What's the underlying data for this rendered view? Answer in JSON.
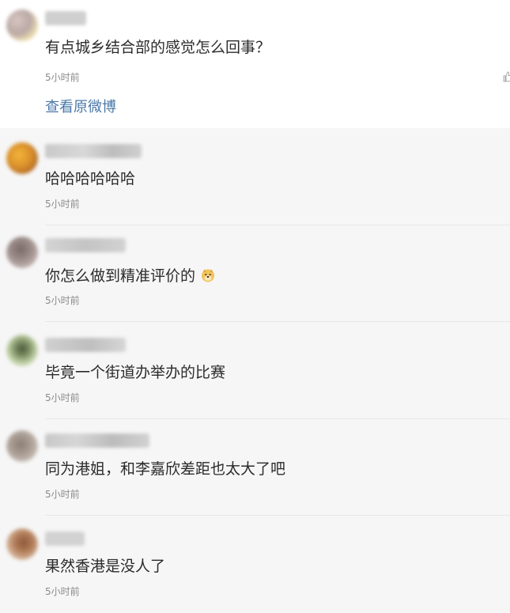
{
  "top_comment": {
    "text": "有点城乡结合部的感觉怎么回事？",
    "time": "5小时前",
    "view_original": "查看原微博",
    "like_icon": "thumbs-up-icon"
  },
  "replies": [
    {
      "text": "哈哈哈哈哈哈",
      "time": "5小时前"
    },
    {
      "text": "你怎么做到精准评价的",
      "time": "5小时前",
      "emoji": "doge-emoji"
    },
    {
      "text": "毕竟一个街道办举办的比赛",
      "time": "5小时前"
    },
    {
      "text": "同为港姐，和李嘉欣差距也太大了吧",
      "time": "5小时前"
    },
    {
      "text": "果然香港是没人了",
      "time": "5小时前"
    }
  ],
  "colors": {
    "link": "#4a78a8",
    "text": "#2b2b2b",
    "muted": "#8b8b8b",
    "reply_background": "#f6f6f6"
  }
}
